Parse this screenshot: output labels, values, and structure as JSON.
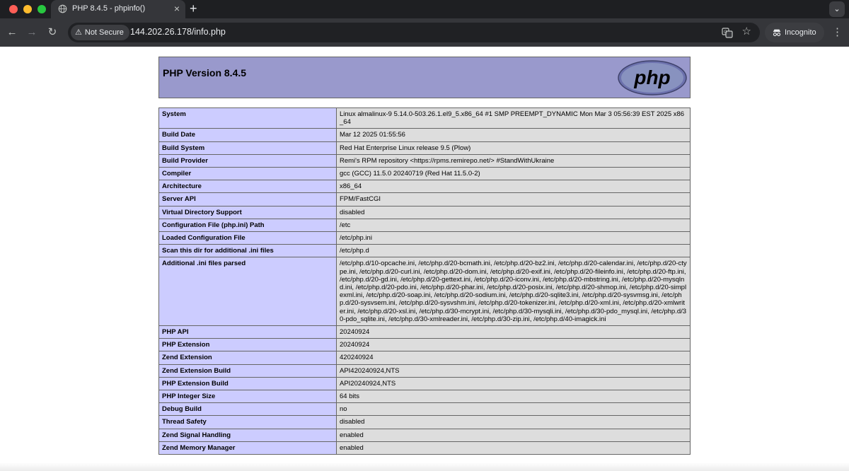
{
  "browser": {
    "tab_title": "PHP 8.4.5 - phpinfo()",
    "tab_close": "×",
    "new_tab": "+",
    "not_secure": "Not Secure",
    "url": "144.202.26.178/info.php",
    "incognito_label": "Incognito",
    "icons": [
      "globe-icon",
      "back-arrow-icon",
      "forward-arrow-icon",
      "reload-icon",
      "warning-icon",
      "translate-icon",
      "star-icon",
      "incognito-icon",
      "chevron-down-icon",
      "menu-dots-icon"
    ]
  },
  "phpinfo": {
    "version_heading": "PHP Version 8.4.5",
    "logo_text": "php",
    "colors": {
      "header": "#9999cc",
      "label_cell": "#ccccff",
      "value_cell": "#dddddd"
    },
    "rows": [
      {
        "k": "System",
        "v": "Linux almalinux-9 5.14.0-503.26.1.el9_5.x86_64 #1 SMP PREEMPT_DYNAMIC Mon Mar 3 05:56:39 EST 2025 x86_64"
      },
      {
        "k": "Build Date",
        "v": "Mar 12 2025 01:55:56"
      },
      {
        "k": "Build System",
        "v": "Red Hat Enterprise Linux release 9.5 (Plow)"
      },
      {
        "k": "Build Provider",
        "v": "Remi's RPM repository <https://rpms.remirepo.net/> #StandWithUkraine"
      },
      {
        "k": "Compiler",
        "v": "gcc (GCC) 11.5.0 20240719 (Red Hat 11.5.0-2)"
      },
      {
        "k": "Architecture",
        "v": "x86_64"
      },
      {
        "k": "Server API",
        "v": "FPM/FastCGI"
      },
      {
        "k": "Virtual Directory Support",
        "v": "disabled"
      },
      {
        "k": "Configuration File (php.ini) Path",
        "v": "/etc"
      },
      {
        "k": "Loaded Configuration File",
        "v": "/etc/php.ini"
      },
      {
        "k": "Scan this dir for additional .ini files",
        "v": "/etc/php.d"
      },
      {
        "k": "Additional .ini files parsed",
        "v": "/etc/php.d/10-opcache.ini, /etc/php.d/20-bcmath.ini, /etc/php.d/20-bz2.ini, /etc/php.d/20-calendar.ini, /etc/php.d/20-ctype.ini, /etc/php.d/20-curl.ini, /etc/php.d/20-dom.ini, /etc/php.d/20-exif.ini, /etc/php.d/20-fileinfo.ini, /etc/php.d/20-ftp.ini, /etc/php.d/20-gd.ini, /etc/php.d/20-gettext.ini, /etc/php.d/20-iconv.ini, /etc/php.d/20-mbstring.ini, /etc/php.d/20-mysqlnd.ini, /etc/php.d/20-pdo.ini, /etc/php.d/20-phar.ini, /etc/php.d/20-posix.ini, /etc/php.d/20-shmop.ini, /etc/php.d/20-simplexml.ini, /etc/php.d/20-soap.ini, /etc/php.d/20-sodium.ini, /etc/php.d/20-sqlite3.ini, /etc/php.d/20-sysvmsg.ini, /etc/php.d/20-sysvsem.ini, /etc/php.d/20-sysvshm.ini, /etc/php.d/20-tokenizer.ini, /etc/php.d/20-xml.ini, /etc/php.d/20-xmlwriter.ini, /etc/php.d/20-xsl.ini, /etc/php.d/30-mcrypt.ini, /etc/php.d/30-mysqli.ini, /etc/php.d/30-pdo_mysql.ini, /etc/php.d/30-pdo_sqlite.ini, /etc/php.d/30-xmlreader.ini, /etc/php.d/30-zip.ini, /etc/php.d/40-imagick.ini"
      },
      {
        "k": "PHP API",
        "v": "20240924"
      },
      {
        "k": "PHP Extension",
        "v": "20240924"
      },
      {
        "k": "Zend Extension",
        "v": "420240924"
      },
      {
        "k": "Zend Extension Build",
        "v": "API420240924,NTS"
      },
      {
        "k": "PHP Extension Build",
        "v": "API20240924,NTS"
      },
      {
        "k": "PHP Integer Size",
        "v": "64 bits"
      },
      {
        "k": "Debug Build",
        "v": "no"
      },
      {
        "k": "Thread Safety",
        "v": "disabled"
      },
      {
        "k": "Zend Signal Handling",
        "v": "enabled"
      },
      {
        "k": "Zend Memory Manager",
        "v": "enabled"
      }
    ]
  }
}
